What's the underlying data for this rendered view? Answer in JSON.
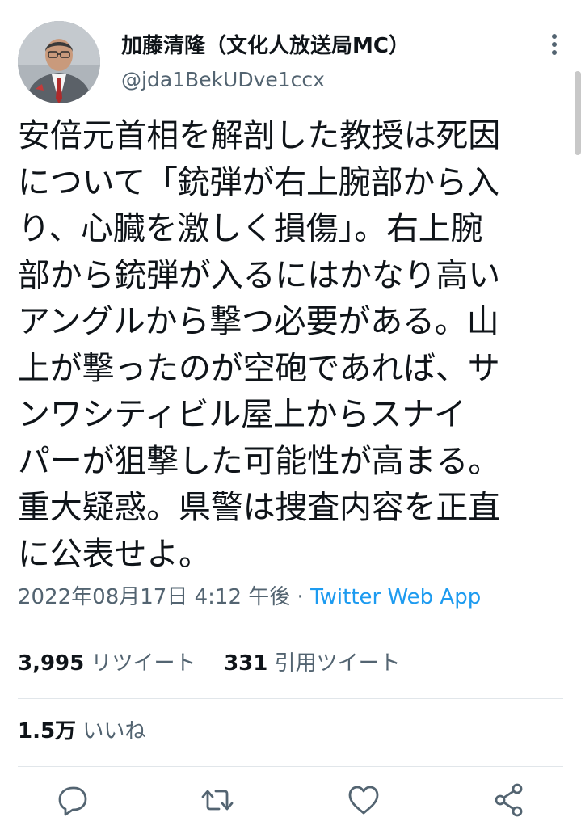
{
  "user": {
    "display_name": "加藤清隆（文化人放送局MC）",
    "handle": "@jda1BekUDve1ccx"
  },
  "tweet": {
    "lines": [
      "安倍元首相を解剖した教授は死因",
      "について「銃弾が右上腕部から入",
      "り、心臓を激しく損傷」。右上腕",
      "部から銃弾が入るにはかなり高い",
      "アングルから撃つ必要がある。山",
      "上が撃ったのが空砲であれば、サ",
      "ンワシティビル屋上からスナイ",
      "パーが狙撃した可能性が高まる。",
      "重大疑惑。県警は捜査内容を正直",
      "に公表せよ。"
    ]
  },
  "meta": {
    "timestamp": "2022年08月17日 4:12 午後",
    "separator": " · ",
    "source": "Twitter Web App"
  },
  "stats": {
    "retweets": "3,995",
    "retweets_label": "リツイート",
    "quotes": "331",
    "quotes_label": "引用ツイート",
    "likes": "1.5万",
    "likes_label": "いいね"
  },
  "icons": {
    "more": "more-icon",
    "reply": "reply-icon",
    "retweet": "retweet-icon",
    "like": "like-icon",
    "share": "share-icon"
  },
  "colors": {
    "text": "#0f1419",
    "secondary": "#536471",
    "link": "#1d9bf0",
    "divider": "#e1e6ea"
  }
}
